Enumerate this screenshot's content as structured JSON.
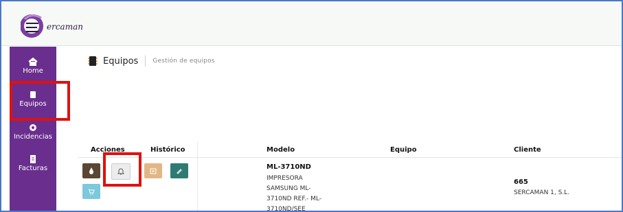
{
  "brand": {
    "logo_text": "ercaman"
  },
  "sidebar": {
    "items": [
      {
        "label": "Home",
        "icon": "home-icon"
      },
      {
        "label": "Equipos",
        "icon": "chip-icon"
      },
      {
        "label": "Incidencias",
        "icon": "headset-icon"
      },
      {
        "label": "Facturas",
        "icon": "invoice-icon"
      }
    ]
  },
  "page": {
    "title": "Equipos",
    "subtitle": "Gestión de equipos"
  },
  "table": {
    "headers": {
      "acciones": "Acciones",
      "historico": "Histórico",
      "modelo": "Modelo",
      "equipo": "Equipo",
      "cliente": "Cliente"
    },
    "row": {
      "model_name": "ML-3710ND",
      "model_desc": "IMPRESORA SAMSUNG ML-3710ND REF.- ML-3710ND/SEE",
      "equipo": "",
      "client_number": "665",
      "client_name": "SERCAMAN 1, S.L."
    }
  },
  "colors": {
    "sidebar": "#6a2e8e",
    "highlight": "#e01010",
    "btn_toner": "#5a4632",
    "btn_alert": "#ececec",
    "btn_history": "#e2b785",
    "btn_edit": "#2f7b74",
    "btn_cart": "#7cc8dc"
  }
}
